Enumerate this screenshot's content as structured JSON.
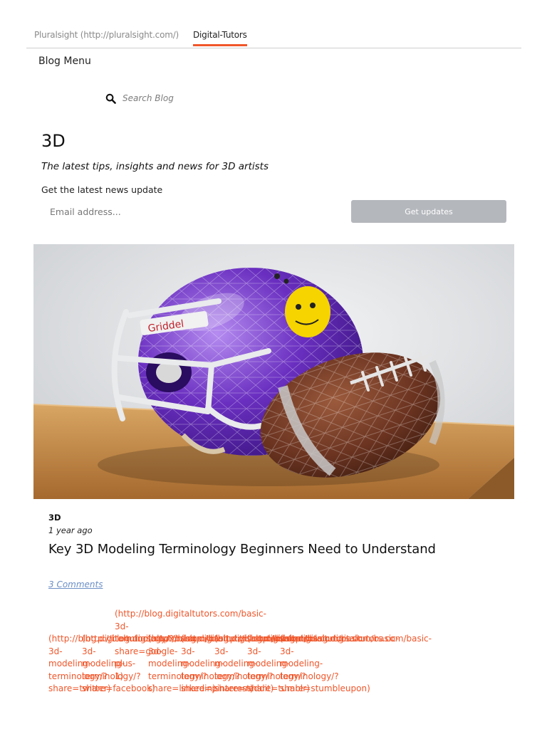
{
  "nav": {
    "tabs": [
      {
        "label": "Pluralsight (http://pluralsight.com/)"
      },
      {
        "label": "Digital-Tutors"
      }
    ]
  },
  "menu": {
    "label": "Blog Menu"
  },
  "search": {
    "placeholder": "Search Blog",
    "icon": "search-icon"
  },
  "category": {
    "title": "3D",
    "description": "The latest tips, insights and news for 3D artists"
  },
  "newsletter": {
    "label": "Get the latest news update",
    "email_placeholder": "Email address...",
    "button_label": "Get updates"
  },
  "colors": {
    "accent": "#f0562a",
    "button_bg": "#b4b7bc",
    "link": "#6b8fc6"
  },
  "post": {
    "category": "3D",
    "time": "1 year ago",
    "title": "Key 3D Modeling Terminology Beginners Need to Understand",
    "comments": "3 Comments",
    "image_alt": "3D wireframe football helmet and football on a wooden board"
  },
  "share_links": [
    {
      "text": "(http://blog.digitaltutors.com/basic-\n3d-\nmodeling-\nterminology/?\nshare=twitter)"
    },
    {
      "text": "(http://blog.digitaltutors.com/basic-\n3d-\nmodeling-\nterminology/?\nshare=facebook)"
    },
    {
      "text": "(http://blog.digitaltutors.com/basic-\n3d-\nterminology/?\nshare=google-\nplus-\n1)"
    },
    {
      "text": "(http://blog.digitaltutors.com/basic-\n3d-\nmodeling-\nterminology/?\nshare=linkedin)"
    },
    {
      "text": "(http://blog.digitaltutors.com/basic-\n3d-\nmodeling-\nterminology/?\nshare=pinterest)"
    },
    {
      "text": "(http://blog.digitaltutors.com/basic-\n3d-\nmodeling-\nterminology/?\nshare=reddit)"
    },
    {
      "text": "(http://blog.digitaltutors.com/basic-\n3d-\nmodeling-\nterminology/?\nshare=tumblr)"
    },
    {
      "text": "(http://blog.digitaltutors.com/basic-\n3d-\nmodeling-\nterminology/?\nshare=stumbleupon)"
    }
  ]
}
